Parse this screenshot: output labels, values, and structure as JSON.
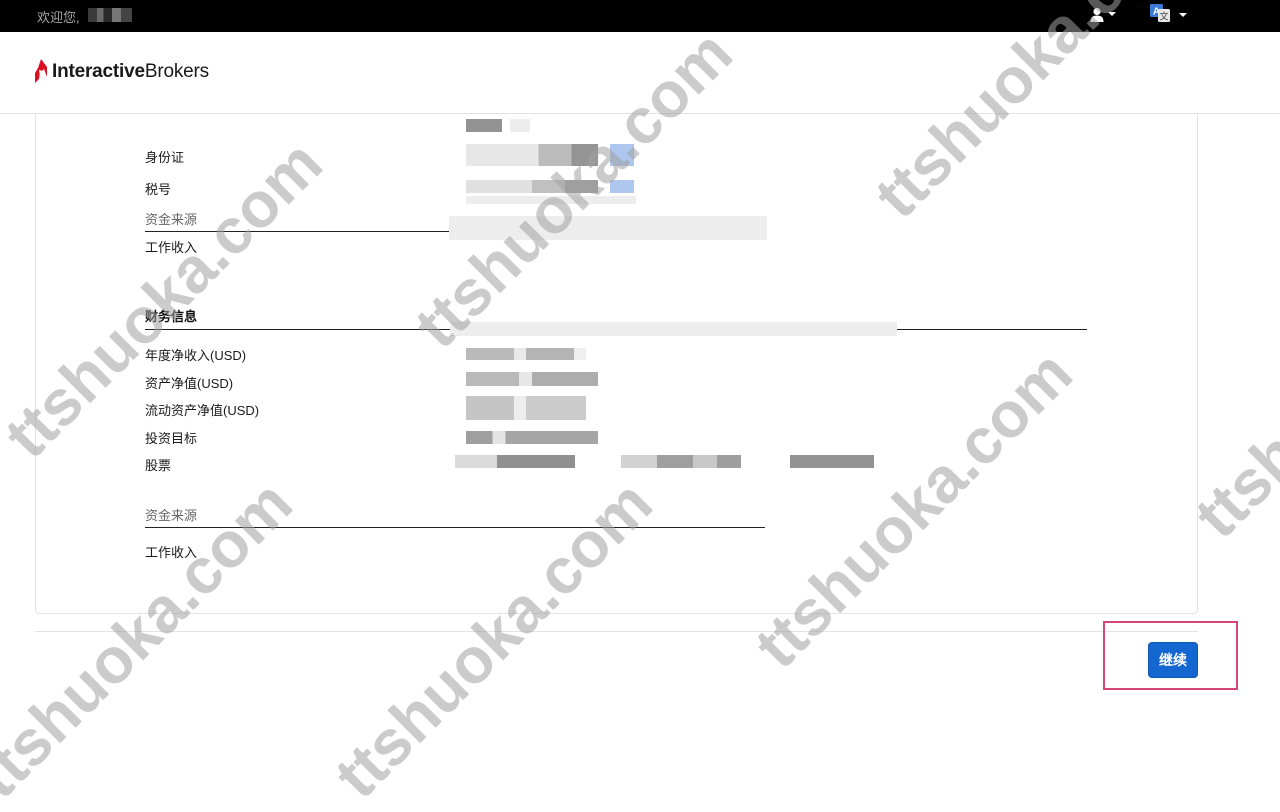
{
  "topbar": {
    "welcome": "欢迎您,",
    "user_icon": "user-icon",
    "language_icon": "translate-icon"
  },
  "header": {
    "logo_bold": "Interactive",
    "logo_regular": "Brokers",
    "brand_color": "#d81222"
  },
  "identity": {
    "id_label": "身份证",
    "tax_label": "税号"
  },
  "funding_section_1": {
    "title": "资金来源",
    "item": "工作收入"
  },
  "financial": {
    "title": "财务信息",
    "rows": [
      "年度净收入(USD)",
      "资产净值(USD)",
      "流动资产净值(USD)",
      "投资目标",
      "股票"
    ]
  },
  "funding_section_2": {
    "title": "资金来源",
    "item": "工作收入"
  },
  "actions": {
    "continue_label": "继续",
    "accent": "#1467d0",
    "highlight_color": "#d2447a"
  },
  "watermark": "ttshuoka.com"
}
